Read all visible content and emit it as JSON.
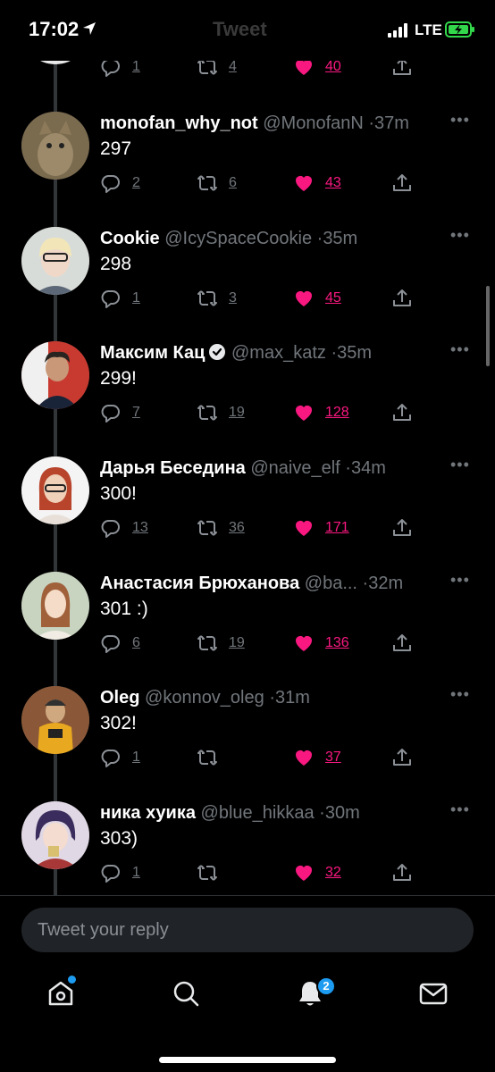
{
  "status_bar": {
    "time": "17:02",
    "ghost_title": "Tweet",
    "network": "LTE"
  },
  "previous_tweet_actions": {
    "replies": "1",
    "retweets": "4",
    "likes": "40"
  },
  "tweets": [
    {
      "name": "monofan_why_not",
      "handle": "@MonofanN",
      "time": "37m",
      "text": "297",
      "replies": "2",
      "retweets": "6",
      "likes": "43",
      "verified": false
    },
    {
      "name": "Cookie",
      "handle": "@IcySpaceCookie",
      "time": "35m",
      "text": "298",
      "replies": "1",
      "retweets": "3",
      "likes": "45",
      "verified": false
    },
    {
      "name": "Максим Кац",
      "handle": "@max_katz",
      "time": "35m",
      "text": "299!",
      "replies": "7",
      "retweets": "19",
      "likes": "128",
      "verified": true
    },
    {
      "name": "Дарья Беседина",
      "handle": "@naive_elf",
      "time": "34m",
      "text": "300!",
      "replies": "13",
      "retweets": "36",
      "likes": "171",
      "verified": false
    },
    {
      "name": "Анастасия Брюханова",
      "handle": "@ba...",
      "time": "32m",
      "text": "301 :)",
      "replies": "6",
      "retweets": "19",
      "likes": "136",
      "verified": false
    },
    {
      "name": "Oleg",
      "handle": "@konnov_oleg",
      "time": "31m",
      "text": "302!",
      "replies": "1",
      "retweets": "",
      "likes": "37",
      "verified": false
    },
    {
      "name": "ника хуика",
      "handle": "@blue_hikkaa",
      "time": "30m",
      "text": "303)",
      "replies": "1",
      "retweets": "",
      "likes": "32",
      "verified": false
    }
  ],
  "separator": "·",
  "reply_box": {
    "placeholder": "Tweet your reply"
  },
  "tab_bar": {
    "notifications_badge": "2"
  },
  "colors": {
    "like": "#f91880",
    "accent": "#1d9bf0",
    "muted": "#71767b",
    "background": "#000000"
  },
  "icons": [
    "reply-icon",
    "retweet-icon",
    "heart-icon",
    "share-icon",
    "more-icon",
    "home-icon",
    "search-icon",
    "bell-icon",
    "mail-icon",
    "verified-icon"
  ]
}
